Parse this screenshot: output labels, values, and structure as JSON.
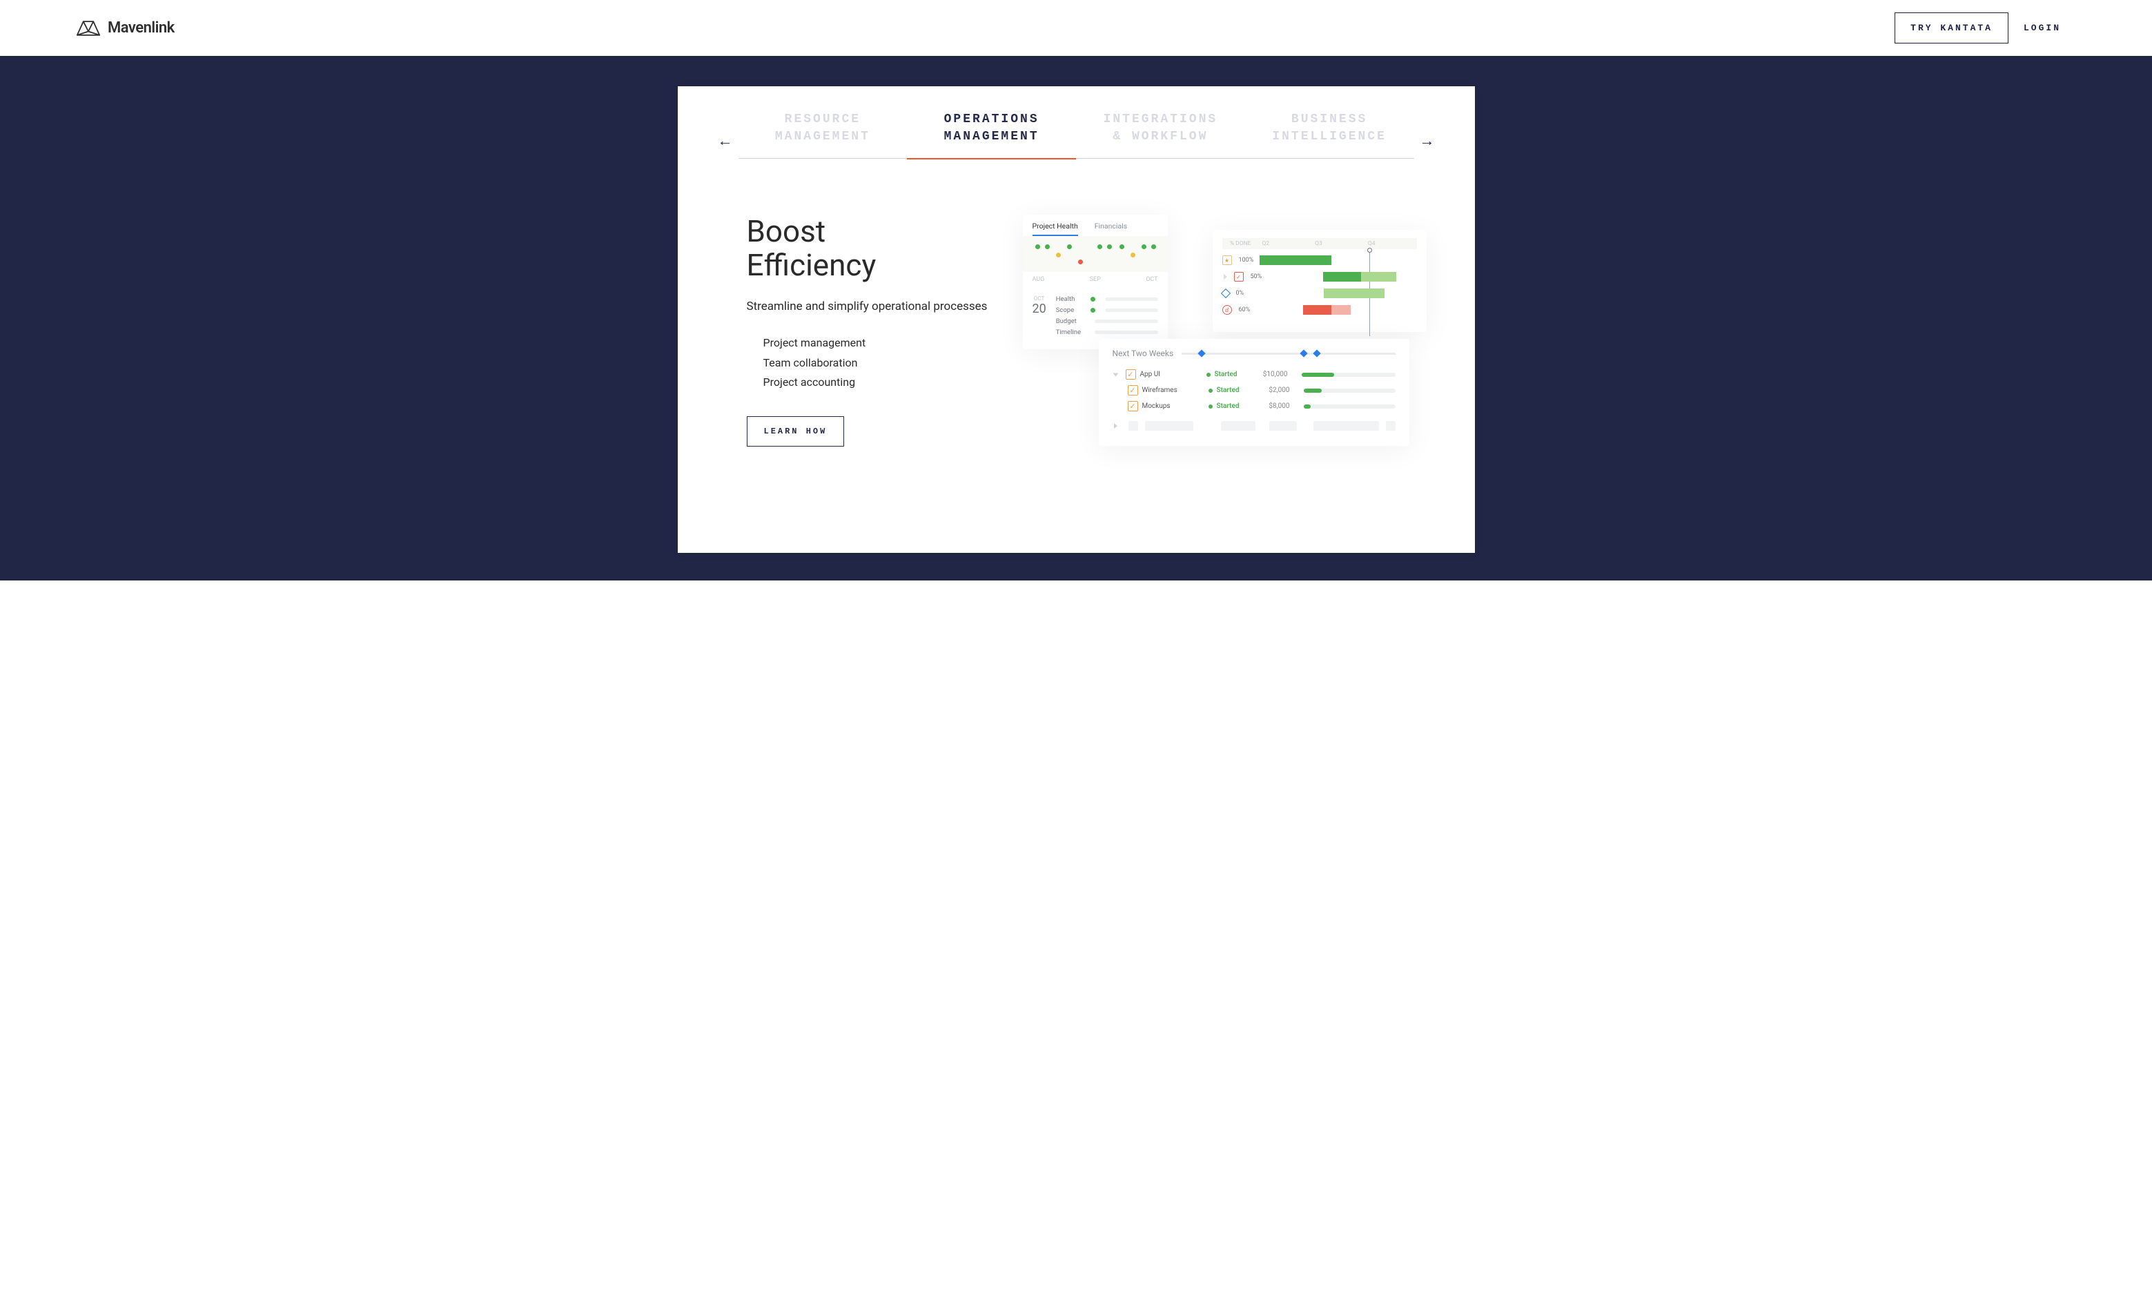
{
  "header": {
    "brand": "Mavenlink",
    "try_btn": "TRY KANTATA",
    "login_btn": "LOGIN"
  },
  "tabs": [
    {
      "l1": "RESOURCE",
      "l2": "MANAGEMENT"
    },
    {
      "l1": "OPERATIONS",
      "l2": "MANAGEMENT"
    },
    {
      "l1": "INTEGRATIONS",
      "l2": "& WORKFLOW"
    },
    {
      "l1": "BUSINESS",
      "l2": "INTELLIGENCE"
    }
  ],
  "copy": {
    "heading_l1": "Boost",
    "heading_l2": "Efficiency",
    "sub": "Streamline and simplify operational processes",
    "bullets": [
      "Project management",
      "Team collaboration",
      "Project accounting"
    ],
    "learn": "LEARN HOW"
  },
  "mock1": {
    "tab_a": "Project Health",
    "tab_b": "Financials",
    "axis": [
      "AUG",
      "SEP",
      "OCT"
    ],
    "date_month": "OCT",
    "date_day": "20",
    "kpis": [
      "Health",
      "Scope",
      "Budget",
      "Timeline"
    ]
  },
  "mock2": {
    "hdr_done": "% DONE",
    "hdr_cols": [
      "Q2",
      "Q3",
      "Q4"
    ],
    "rows": [
      {
        "pct": "100%",
        "bars": [
          {
            "l": 0,
            "w": 46,
            "c": "#4caf50"
          }
        ]
      },
      {
        "pct": "50%",
        "bars": [
          {
            "l": 36,
            "w": 26,
            "c": "#4caf50"
          },
          {
            "l": 62,
            "w": 24,
            "c": "#a8d98f"
          }
        ]
      },
      {
        "pct": "0%",
        "bars": [
          {
            "l": 42,
            "w": 38,
            "c": "#a8d98f"
          }
        ]
      },
      {
        "pct": "60%",
        "bars": [
          {
            "l": 28,
            "w": 18,
            "c": "#e85c4a"
          },
          {
            "l": 46,
            "w": 12,
            "c": "#f3b1a8"
          }
        ]
      }
    ]
  },
  "mock3": {
    "title": "Next Two Weeks",
    "rows": [
      {
        "name": "App UI",
        "status": "Started",
        "amt": "$10,000",
        "fill": 35
      },
      {
        "name": "Wireframes",
        "status": "Started",
        "amt": "$2,000",
        "fill": 20
      },
      {
        "name": "Mockups",
        "status": "Started",
        "amt": "$8,000",
        "fill": 8
      }
    ]
  }
}
